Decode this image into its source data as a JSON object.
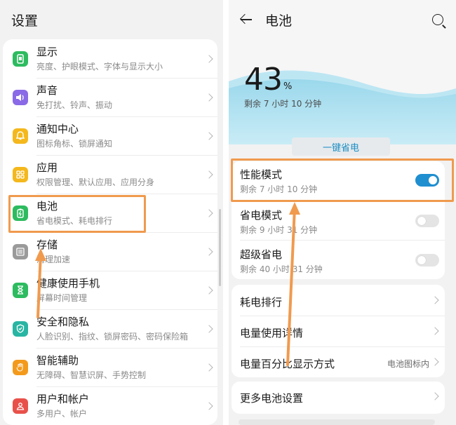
{
  "left": {
    "title": "设置",
    "items": [
      {
        "title": "显示",
        "subtitle": "亮度、护眼模式、字体与显示大小",
        "icon": "display-icon",
        "color": "#2dbb5f"
      },
      {
        "title": "声音",
        "subtitle": "免打扰、铃声、振动",
        "icon": "sound-icon",
        "color": "#8a6ae6"
      },
      {
        "title": "通知中心",
        "subtitle": "图标角标、锁屏通知",
        "icon": "bell-icon",
        "color": "#f4b81d"
      },
      {
        "title": "应用",
        "subtitle": "权限管理、默认应用、应用分身",
        "icon": "apps-icon",
        "color": "#f4b81d"
      },
      {
        "title": "电池",
        "subtitle": "省电模式、耗电排行",
        "icon": "battery-icon",
        "color": "#2dbb5f"
      },
      {
        "title": "存储",
        "subtitle": "清理加速",
        "icon": "storage-icon",
        "color": "#9a9a9a"
      },
      {
        "title": "健康使用手机",
        "subtitle": "屏幕时间管理",
        "icon": "hourglass-icon",
        "color": "#2dbb5f"
      },
      {
        "title": "安全和隐私",
        "subtitle": "人脸识别、指纹、锁屏密码、密码保险箱",
        "icon": "shield-icon",
        "color": "#28b5a3"
      },
      {
        "title": "智能辅助",
        "subtitle": "无障碍、智慧识屏、手势控制",
        "icon": "hand-icon",
        "color": "#f39a1c"
      },
      {
        "title": "用户和帐户",
        "subtitle": "多用户、帐户",
        "icon": "user-icon",
        "color": "#e8514a"
      }
    ]
  },
  "right": {
    "title": "电池",
    "percent": "43",
    "percent_sign": "%",
    "remaining": "剩余 7 小时 10 分钟",
    "one_click_save": "一键省电",
    "modes": [
      {
        "title": "性能模式",
        "subtitle": "剩余 7 小时 10 分钟",
        "enabled": true
      },
      {
        "title": "省电模式",
        "subtitle": "剩余 9 小时 31 分钟",
        "enabled": false
      },
      {
        "title": "超级省电",
        "subtitle": "剩余 40 小时 31 分钟",
        "enabled": false
      }
    ],
    "links": [
      {
        "title": "耗电排行"
      },
      {
        "title": "电量使用详情"
      },
      {
        "title": "电量百分比显示方式",
        "value": "电池图标内"
      }
    ],
    "more": "更多电池设置"
  },
  "colors": {
    "accent": "#1f8fd0",
    "highlight": "#f09a4e",
    "wave": "#8fd3e8"
  }
}
